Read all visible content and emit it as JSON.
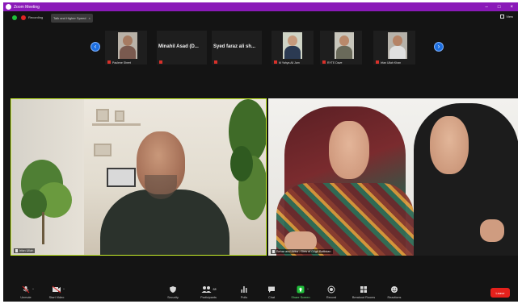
{
  "window": {
    "title": "Zoom Meeting",
    "controls": [
      "–",
      "□",
      "×"
    ]
  },
  "infobar": {
    "recording_label": "Recording",
    "topic": "Talk and Higher Speed",
    "view_label": "View"
  },
  "thumbnails": [
    {
      "name": "Paulene Sheet",
      "skin": "#a67b62",
      "clothes": "#7a5a4f",
      "bg": "#b9b2a8"
    },
    {
      "big_text": "Minahil Asad (D..."
    },
    {
      "big_text": "Syed faraz ali sh..."
    },
    {
      "name": "M Yahya Ali Jam",
      "skin": "#c69a7c",
      "clothes": "#2b3a52",
      "bg": "#cfd4c6"
    },
    {
      "name": "RYTE Dave",
      "skin": "#b9896b",
      "clothes": "#6a6a5a",
      "bg": "#c8c6bc"
    },
    {
      "name": "Irfan Ullah Khan",
      "skin": "#b58366",
      "clothes": "#e0e0e0",
      "bg": "#b6b2aa"
    }
  ],
  "tiles": {
    "left_name": "Irfan Ullah",
    "right_name": "Sehar and Atika - Girls of Gilgit Baltistan"
  },
  "toolbar": {
    "items": [
      {
        "label": "Unmute",
        "icon": "microphone-muted-icon"
      },
      {
        "label": "Start Video",
        "icon": "video-off-icon"
      },
      {
        "label": "Security",
        "icon": "shield-icon"
      },
      {
        "label": "Participants",
        "icon": "participants-icon",
        "count": "88"
      },
      {
        "label": "Polls",
        "icon": "polls-icon"
      },
      {
        "label": "Chat",
        "icon": "chat-icon"
      },
      {
        "label": "Share Screen",
        "icon": "share-screen-icon"
      },
      {
        "label": "Record",
        "icon": "record-icon"
      },
      {
        "label": "Breakout Rooms",
        "icon": "breakout-rooms-icon"
      },
      {
        "label": "Reactions",
        "icon": "reactions-icon"
      }
    ],
    "end_label": "Leave"
  },
  "colors": {
    "title_bar": "#8a1ab8",
    "active_speaker_border": "#c8f02a",
    "share_screen_green": "#1fbf3a",
    "end_red": "#e5211c",
    "arrow_blue": "#1d6fe0"
  }
}
